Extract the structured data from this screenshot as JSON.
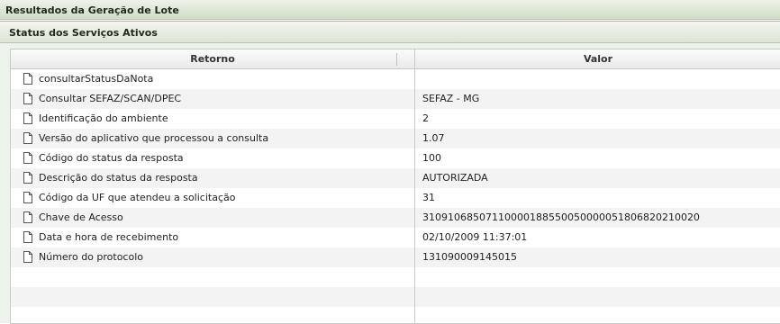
{
  "window": {
    "title": "Resultados da Geração de Lote"
  },
  "panel": {
    "title": "Status dos Serviços Ativos"
  },
  "grid": {
    "columns": [
      "Retorno",
      "Valor"
    ],
    "rows": [
      {
        "label": "consultarStatusDaNota",
        "value": ""
      },
      {
        "label": "Consultar SEFAZ/SCAN/DPEC",
        "value": "SEFAZ - MG"
      },
      {
        "label": "Identificação do ambiente",
        "value": "2"
      },
      {
        "label": "Versão do aplicativo que processou a consulta",
        "value": "1.07"
      },
      {
        "label": "Código do status da resposta",
        "value": "100"
      },
      {
        "label": "Descrição do status da resposta",
        "value": "AUTORIZADA"
      },
      {
        "label": "Código da UF que atendeu a solicitação",
        "value": "31"
      },
      {
        "label": "Chave de Acesso",
        "value": "31091068507110000188550050000051806820210020"
      },
      {
        "label": "Data e hora de recebimento",
        "value": "02/10/2009 11:37:01"
      },
      {
        "label": "Número do protocolo",
        "value": "131090009145015"
      },
      {
        "label": "",
        "value": ""
      },
      {
        "label": "",
        "value": ""
      },
      {
        "label": "",
        "value": ""
      }
    ],
    "row_icon": "document-icon"
  }
}
